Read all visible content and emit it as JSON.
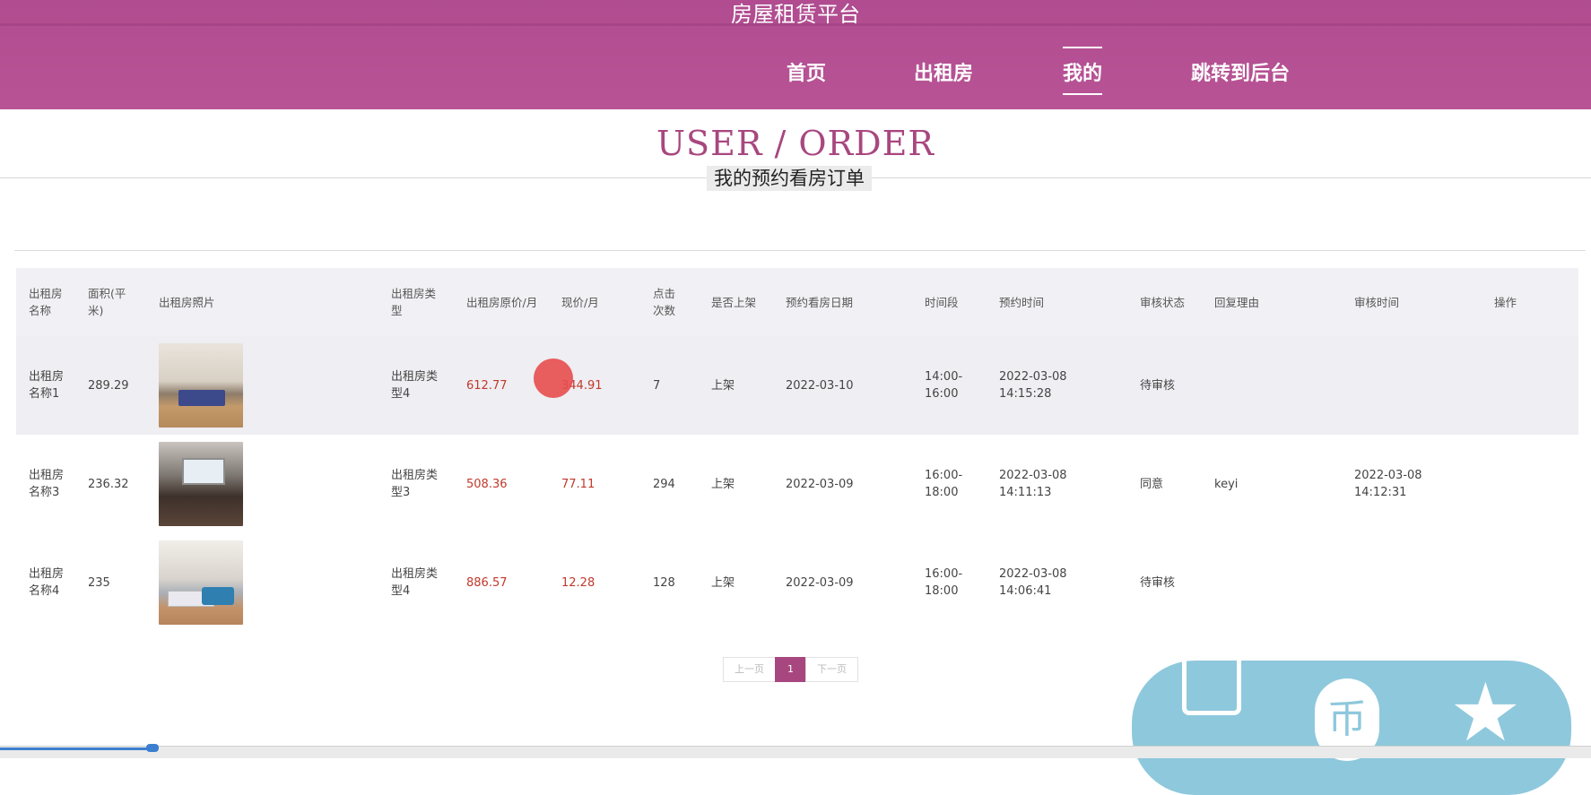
{
  "site": {
    "title": "房屋租赁平台"
  },
  "nav": {
    "items": [
      {
        "label": "首页"
      },
      {
        "label": "出租房"
      },
      {
        "label": "我的"
      },
      {
        "label": "跳转到后台"
      }
    ],
    "active": "我的"
  },
  "page": {
    "heading": "USER / ORDER",
    "subtitle": "我的预约看房订单"
  },
  "table": {
    "headers": [
      "出租房名称",
      "面积(平米)",
      "出租房照片",
      "出租房类型",
      "出租房原价/月",
      "现价/月",
      "点击次数",
      "是否上架",
      "预约看房日期",
      "时间段",
      "预约时间",
      "审核状态",
      "回复理由",
      "审核时间",
      "操作"
    ],
    "rows": [
      {
        "name": "出租房名称1",
        "area": "289.29",
        "type": "出租房类型4",
        "orig_price": "612.77",
        "price": "344.91",
        "clicks": "7",
        "listed": "上架",
        "visit_date": "2022-03-10",
        "period": "14:00-16:00",
        "booked_at": "2022-03-08 14:15:28",
        "status": "待审核",
        "reply": "",
        "reviewed_at": ""
      },
      {
        "name": "出租房名称3",
        "area": "236.32",
        "type": "出租房类型3",
        "orig_price": "508.36",
        "price": "77.11",
        "clicks": "294",
        "listed": "上架",
        "visit_date": "2022-03-09",
        "period": "16:00-18:00",
        "booked_at": "2022-03-08 14:11:13",
        "status": "同意",
        "reply": "keyi",
        "reviewed_at": "2022-03-08 14:12:31"
      },
      {
        "name": "出租房名称4",
        "area": "235",
        "type": "出租房类型4",
        "orig_price": "886.57",
        "price": "12.28",
        "clicks": "128",
        "listed": "上架",
        "visit_date": "2022-03-09",
        "period": "16:00-18:00",
        "booked_at": "2022-03-08 14:06:41",
        "status": "待审核",
        "reply": "",
        "reviewed_at": ""
      }
    ]
  },
  "pagination": {
    "prev": "上一页",
    "current": "1",
    "next": "下一页"
  },
  "widget": {
    "circle_glyph": "币",
    "star_glyph": "★"
  },
  "colors": {
    "brand": "#b04c8f",
    "accent": "#a8477f",
    "price": "#c0392b"
  }
}
